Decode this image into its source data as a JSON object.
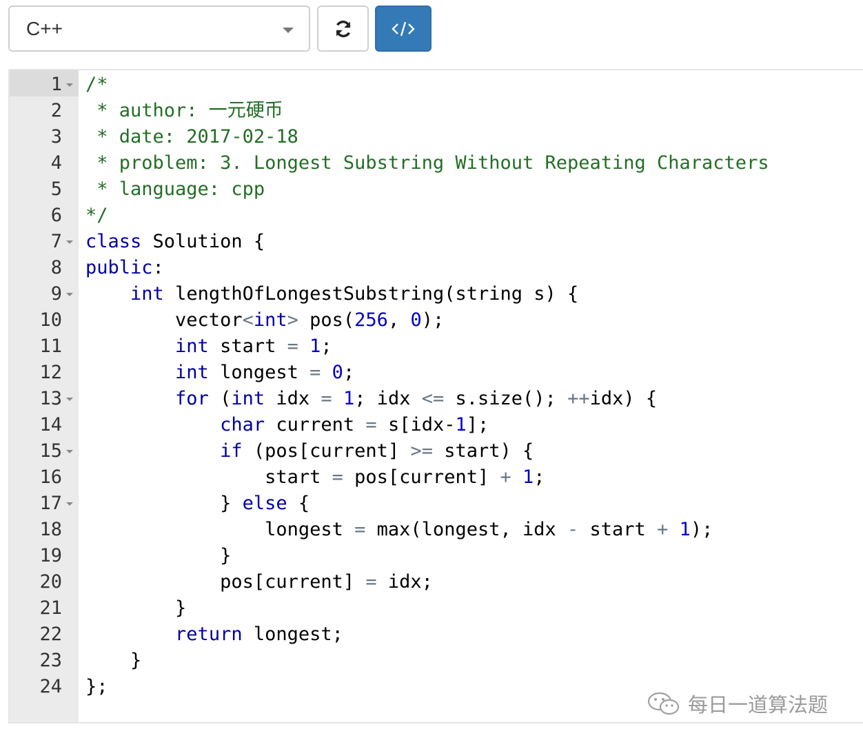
{
  "toolbar": {
    "language_value": "C++",
    "refresh_icon": "refresh-icon",
    "code_icon": "code-icon",
    "accent_color": "#337ab7"
  },
  "editor": {
    "lines": [
      {
        "num": "1",
        "fold": true,
        "tokens": [
          {
            "t": "/*",
            "c": "comment"
          }
        ]
      },
      {
        "num": "2",
        "fold": false,
        "tokens": [
          {
            "t": " * author: 一元硬币",
            "c": "comment"
          }
        ]
      },
      {
        "num": "3",
        "fold": false,
        "tokens": [
          {
            "t": " * date: 2017-02-18",
            "c": "comment"
          }
        ]
      },
      {
        "num": "4",
        "fold": false,
        "tokens": [
          {
            "t": " * problem: 3. Longest Substring Without Repeating Characters",
            "c": "comment"
          }
        ]
      },
      {
        "num": "5",
        "fold": false,
        "tokens": [
          {
            "t": " * language: cpp",
            "c": "comment"
          }
        ]
      },
      {
        "num": "6",
        "fold": false,
        "tokens": [
          {
            "t": "*/",
            "c": "comment"
          }
        ]
      },
      {
        "num": "7",
        "fold": true,
        "tokens": [
          {
            "t": "class",
            "c": "keyword"
          },
          {
            "t": " Solution {",
            "c": "plain"
          }
        ]
      },
      {
        "num": "8",
        "fold": false,
        "tokens": [
          {
            "t": "public",
            "c": "keyword"
          },
          {
            "t": ":",
            "c": "plain"
          }
        ]
      },
      {
        "num": "9",
        "fold": true,
        "tokens": [
          {
            "t": "    ",
            "c": "plain"
          },
          {
            "t": "int",
            "c": "keyword"
          },
          {
            "t": " lengthOfLongestSubstring(string s) {",
            "c": "plain"
          }
        ]
      },
      {
        "num": "10",
        "fold": false,
        "tokens": [
          {
            "t": "        vector",
            "c": "plain"
          },
          {
            "t": "<",
            "c": "op"
          },
          {
            "t": "int",
            "c": "keyword"
          },
          {
            "t": ">",
            "c": "op"
          },
          {
            "t": " pos(",
            "c": "plain"
          },
          {
            "t": "256",
            "c": "number"
          },
          {
            "t": ", ",
            "c": "plain"
          },
          {
            "t": "0",
            "c": "number"
          },
          {
            "t": ");",
            "c": "plain"
          }
        ]
      },
      {
        "num": "11",
        "fold": false,
        "tokens": [
          {
            "t": "        ",
            "c": "plain"
          },
          {
            "t": "int",
            "c": "keyword"
          },
          {
            "t": " start ",
            "c": "plain"
          },
          {
            "t": "=",
            "c": "op"
          },
          {
            "t": " ",
            "c": "plain"
          },
          {
            "t": "1",
            "c": "number"
          },
          {
            "t": ";",
            "c": "plain"
          }
        ]
      },
      {
        "num": "12",
        "fold": false,
        "tokens": [
          {
            "t": "        ",
            "c": "plain"
          },
          {
            "t": "int",
            "c": "keyword"
          },
          {
            "t": " longest ",
            "c": "plain"
          },
          {
            "t": "=",
            "c": "op"
          },
          {
            "t": " ",
            "c": "plain"
          },
          {
            "t": "0",
            "c": "number"
          },
          {
            "t": ";",
            "c": "plain"
          }
        ]
      },
      {
        "num": "13",
        "fold": true,
        "tokens": [
          {
            "t": "        ",
            "c": "plain"
          },
          {
            "t": "for",
            "c": "keyword"
          },
          {
            "t": " (",
            "c": "plain"
          },
          {
            "t": "int",
            "c": "keyword"
          },
          {
            "t": " idx ",
            "c": "plain"
          },
          {
            "t": "=",
            "c": "op"
          },
          {
            "t": " ",
            "c": "plain"
          },
          {
            "t": "1",
            "c": "number"
          },
          {
            "t": "; idx ",
            "c": "plain"
          },
          {
            "t": "<=",
            "c": "op"
          },
          {
            "t": " s.size(); ",
            "c": "plain"
          },
          {
            "t": "++",
            "c": "op"
          },
          {
            "t": "idx) {",
            "c": "plain"
          }
        ]
      },
      {
        "num": "14",
        "fold": false,
        "tokens": [
          {
            "t": "            ",
            "c": "plain"
          },
          {
            "t": "char",
            "c": "keyword"
          },
          {
            "t": " current ",
            "c": "plain"
          },
          {
            "t": "=",
            "c": "op"
          },
          {
            "t": " s[idx-",
            "c": "plain"
          },
          {
            "t": "1",
            "c": "number"
          },
          {
            "t": "];",
            "c": "plain"
          }
        ]
      },
      {
        "num": "15",
        "fold": true,
        "tokens": [
          {
            "t": "            ",
            "c": "plain"
          },
          {
            "t": "if",
            "c": "keyword"
          },
          {
            "t": " (pos[current] ",
            "c": "plain"
          },
          {
            "t": ">=",
            "c": "op"
          },
          {
            "t": " start) {",
            "c": "plain"
          }
        ]
      },
      {
        "num": "16",
        "fold": false,
        "tokens": [
          {
            "t": "                start ",
            "c": "plain"
          },
          {
            "t": "=",
            "c": "op"
          },
          {
            "t": " pos[current] ",
            "c": "plain"
          },
          {
            "t": "+",
            "c": "op"
          },
          {
            "t": " ",
            "c": "plain"
          },
          {
            "t": "1",
            "c": "number"
          },
          {
            "t": ";",
            "c": "plain"
          }
        ]
      },
      {
        "num": "17",
        "fold": true,
        "tokens": [
          {
            "t": "            } ",
            "c": "plain"
          },
          {
            "t": "else",
            "c": "keyword"
          },
          {
            "t": " {",
            "c": "plain"
          }
        ]
      },
      {
        "num": "18",
        "fold": false,
        "tokens": [
          {
            "t": "                longest ",
            "c": "plain"
          },
          {
            "t": "=",
            "c": "op"
          },
          {
            "t": " max(longest, idx ",
            "c": "plain"
          },
          {
            "t": "-",
            "c": "op"
          },
          {
            "t": " start ",
            "c": "plain"
          },
          {
            "t": "+",
            "c": "op"
          },
          {
            "t": " ",
            "c": "plain"
          },
          {
            "t": "1",
            "c": "number"
          },
          {
            "t": ");",
            "c": "plain"
          }
        ]
      },
      {
        "num": "19",
        "fold": false,
        "tokens": [
          {
            "t": "            }",
            "c": "plain"
          }
        ]
      },
      {
        "num": "20",
        "fold": false,
        "tokens": [
          {
            "t": "            pos[current] ",
            "c": "plain"
          },
          {
            "t": "=",
            "c": "op"
          },
          {
            "t": " idx;",
            "c": "plain"
          }
        ]
      },
      {
        "num": "21",
        "fold": false,
        "tokens": [
          {
            "t": "        }",
            "c": "plain"
          }
        ]
      },
      {
        "num": "22",
        "fold": false,
        "tokens": [
          {
            "t": "        ",
            "c": "plain"
          },
          {
            "t": "return",
            "c": "keyword"
          },
          {
            "t": " longest;",
            "c": "plain"
          }
        ]
      },
      {
        "num": "23",
        "fold": false,
        "tokens": [
          {
            "t": "    }",
            "c": "plain"
          }
        ]
      },
      {
        "num": "24",
        "fold": false,
        "tokens": [
          {
            "t": "};",
            "c": "plain"
          }
        ]
      }
    ]
  },
  "watermark": {
    "text": "每日一道算法题",
    "icon": "wechat-icon"
  }
}
